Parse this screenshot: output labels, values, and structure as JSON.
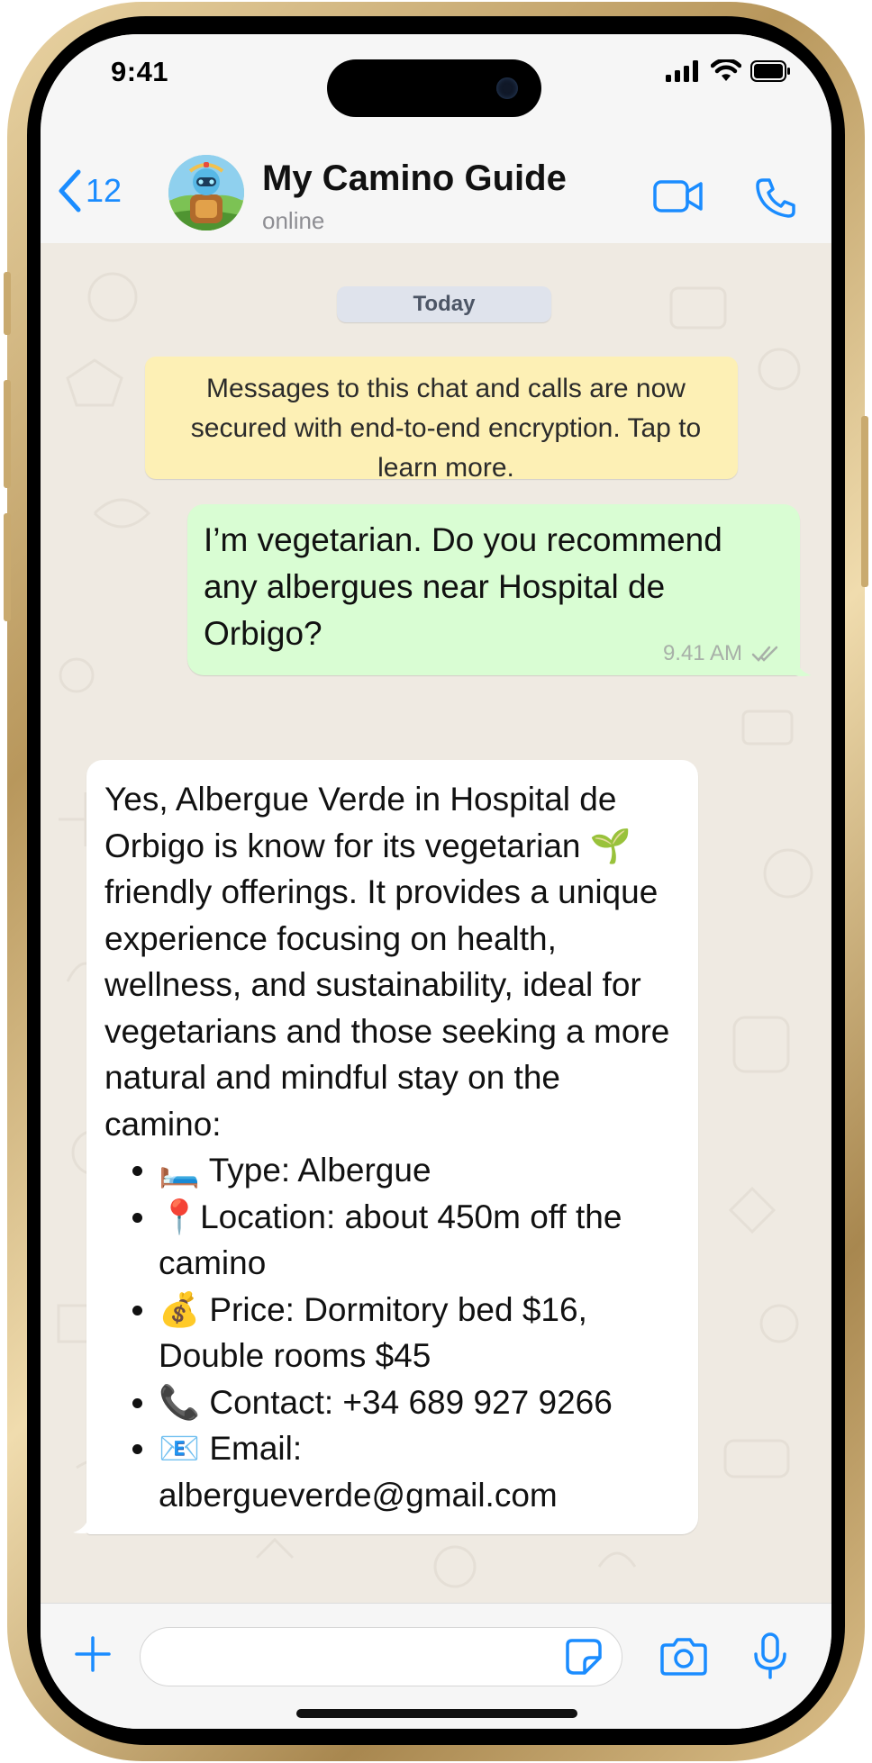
{
  "status_bar": {
    "time": "9:41"
  },
  "header": {
    "back_count": "12",
    "title": "My Camino Guide",
    "subtitle": "online",
    "avatar_icon": "robot-hiker-avatar",
    "accent_color": "#1a8cff"
  },
  "chat": {
    "date_label": "Today",
    "encryption_notice": "Messages to this chat and calls are now secured with end-to-end encryption. Tap to learn more.",
    "outgoing": {
      "text": "I’m vegetarian. Do you recommend any albergues near Hospital de Orbigo?",
      "time": "9.41 AM",
      "status_icon": "double-check-icon",
      "bubble_color": "#d9fdd3"
    },
    "incoming": {
      "intro": "Yes, Albergue Verde in Hospital de Orbigo is know for its vegetarian",
      "intro_emoji": "🌱",
      "intro_rest": "friendly offerings. It provides a unique experience focusing on health, wellness, and sustainability, ideal for vegetarians and those seeking a more natural and mindful stay on the camino:",
      "items": [
        {
          "emoji": "🛏️",
          "label": "Type: Albergue"
        },
        {
          "emoji": "📍",
          "label": "Location: about 450m off the camino"
        },
        {
          "emoji": "💰",
          "label": "Price: Dormitory bed $16, Double rooms $45"
        },
        {
          "emoji": "📞",
          "label": "Contact: +34 689 927 9266"
        },
        {
          "emoji": "📧",
          "label": "Email: albergueverde@gmail.com"
        }
      ]
    }
  },
  "input_bar": {
    "placeholder": ""
  }
}
